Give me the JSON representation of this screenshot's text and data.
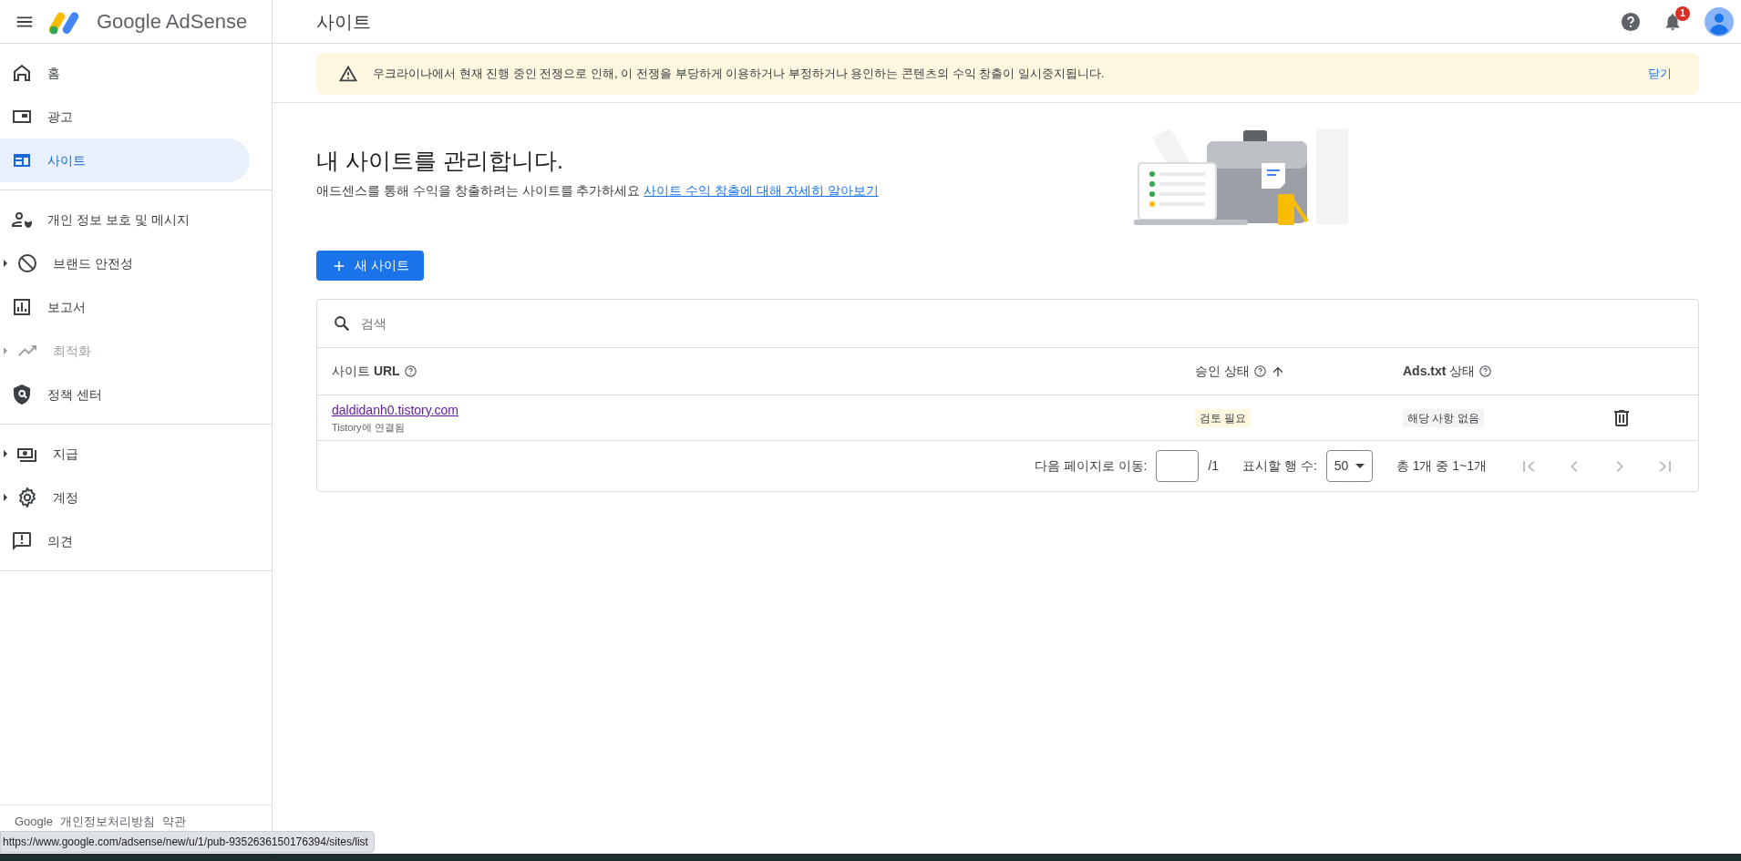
{
  "topbar": {
    "product": "Google AdSense",
    "page_title": "사이트",
    "notifications": "1"
  },
  "sidebar": {
    "groups": [
      {
        "items": [
          {
            "label": "홈",
            "selected": false,
            "expandable": false,
            "disabled": false
          },
          {
            "label": "광고",
            "selected": false,
            "expandable": false,
            "disabled": false
          },
          {
            "label": "사이트",
            "selected": true,
            "expandable": false,
            "disabled": false
          }
        ]
      },
      {
        "items": [
          {
            "label": "개인 정보 보호 및 메시지",
            "selected": false,
            "expandable": false,
            "disabled": false
          },
          {
            "label": "브랜드 안전성",
            "selected": false,
            "expandable": true,
            "disabled": false
          },
          {
            "label": "보고서",
            "selected": false,
            "expandable": false,
            "disabled": false
          },
          {
            "label": "최적화",
            "selected": false,
            "expandable": true,
            "disabled": true
          },
          {
            "label": "정책 센터",
            "selected": false,
            "expandable": false,
            "disabled": false
          }
        ]
      },
      {
        "items": [
          {
            "label": "지급",
            "selected": false,
            "expandable": true,
            "disabled": false
          },
          {
            "label": "계정",
            "selected": false,
            "expandable": true,
            "disabled": false
          },
          {
            "label": "의견",
            "selected": false,
            "expandable": false,
            "disabled": false
          }
        ]
      }
    ],
    "footer": [
      "Google",
      "개인정보처리방침",
      "약관"
    ]
  },
  "banner": {
    "message": "우크라이나에서 현재 진행 중인 전쟁으로 인해, 이 전쟁을 부당하게 이용하거나 부정하거나 용인하는 콘텐츠의 수익 창출이 일시중지됩니다.",
    "action": "닫기"
  },
  "intro": {
    "heading": "내 사이트를 관리합니다.",
    "text": "애드센스를 통해 수익을 창출하려는 사이트를 추가하세요",
    "link": "사이트 수익 창출에 대해 자세히 알아보기"
  },
  "new_site_button": "새 사이트",
  "table": {
    "search": {
      "placeholder": "검색"
    },
    "columns": [
      {
        "label": "사이트 **URL**",
        "sorted": false
      },
      {
        "label": "승인 상태",
        "sorted": true
      },
      {
        "label": "**Ads.txt** 상태",
        "sorted": false
      }
    ],
    "rows": [
      {
        "url": "daldidanh0.tistory.com",
        "connection": "Tistory에 연결됨",
        "approval": {
          "text": "검토 필요",
          "color": "#fef7e0"
        },
        "ads_txt": {
          "text": "해당 사항 없음",
          "color": "#f1f3f4"
        }
      }
    ],
    "pagination": {
      "goto_label": "다음 페이지로 이동:",
      "page_total": "/1",
      "rows_label": "표시할 행 수:",
      "rows_value": "50",
      "range": "총 1개 중 1~1개",
      "nav_disabled": [
        true,
        true,
        true,
        true
      ]
    }
  },
  "status_url": "https://www.google.com/adsense/new/u/1/pub-9352636150176394/sites/list"
}
